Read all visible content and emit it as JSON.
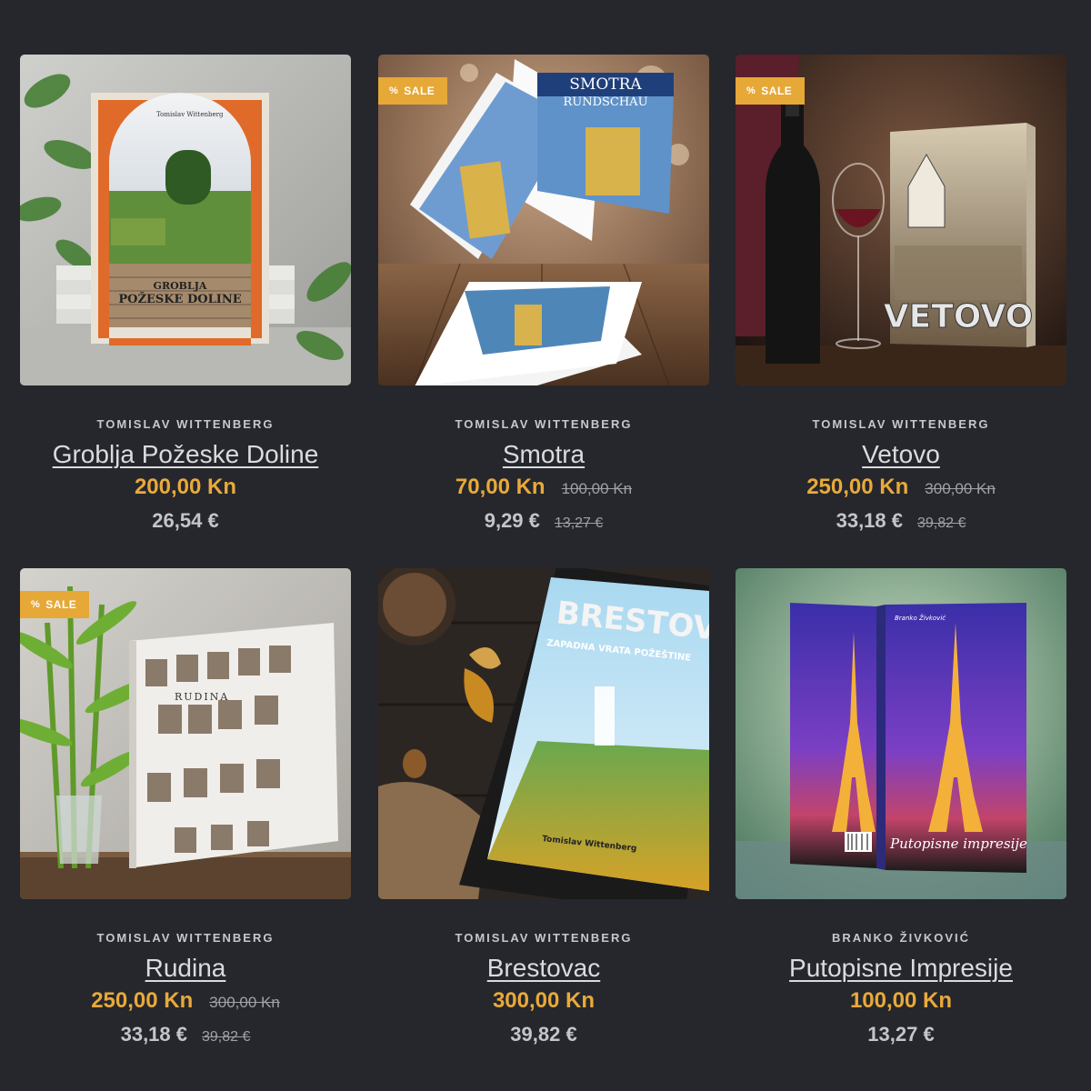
{
  "colors": {
    "background": "#25272c",
    "accent": "#e9a93a",
    "badge": "#e6a837",
    "title": "#d9dbde"
  },
  "sale_badge_label": "SALE",
  "sale_badge_icon": "percent-icon",
  "products": [
    {
      "author": "TOMISLAV WITTENBERG",
      "title": "Groblja Požeske Doline",
      "price_kn": "200,00 Kn",
      "old_price_kn": "",
      "price_eur": "26,54 €",
      "old_price_eur": "",
      "on_sale": false,
      "cover_texts": [
        "Tomislav Wittenberg",
        "GROBLJA",
        "POŽESKE DOLINE"
      ]
    },
    {
      "author": "TOMISLAV WITTENBERG",
      "title": "Smotra",
      "price_kn": "70,00 Kn",
      "old_price_kn": "100,00 Kn",
      "price_eur": "9,29 €",
      "old_price_eur": "13,27 €",
      "on_sale": true,
      "cover_texts": [
        "SMOTRA",
        "RUNDSCHAU"
      ]
    },
    {
      "author": "TOMISLAV WITTENBERG",
      "title": "Vetovo",
      "price_kn": "250,00 Kn",
      "old_price_kn": "300,00 Kn",
      "price_eur": "33,18 €",
      "old_price_eur": "39,82 €",
      "on_sale": true,
      "cover_texts": [
        "VETOVO"
      ]
    },
    {
      "author": "TOMISLAV WITTENBERG",
      "title": "Rudina",
      "price_kn": "250,00 Kn",
      "old_price_kn": "300,00 Kn",
      "price_eur": "33,18 €",
      "old_price_eur": "39,82 €",
      "on_sale": true,
      "cover_texts": [
        "RUDINA"
      ]
    },
    {
      "author": "TOMISLAV WITTENBERG",
      "title": "Brestovac",
      "price_kn": "300,00 Kn",
      "old_price_kn": "",
      "price_eur": "39,82 €",
      "old_price_eur": "",
      "on_sale": false,
      "cover_texts": [
        "BRESTOVAC",
        "ZAPADNA VRATA POŽEŠTINE",
        "Tomislav Wittenberg"
      ]
    },
    {
      "author": "BRANKO ŽIVKOVIĆ",
      "title": "Putopisne Impresije",
      "price_kn": "100,00 Kn",
      "old_price_kn": "",
      "price_eur": "13,27 €",
      "old_price_eur": "",
      "on_sale": false,
      "cover_texts": [
        "Branko Živković",
        "Putopisne impresije"
      ]
    }
  ]
}
